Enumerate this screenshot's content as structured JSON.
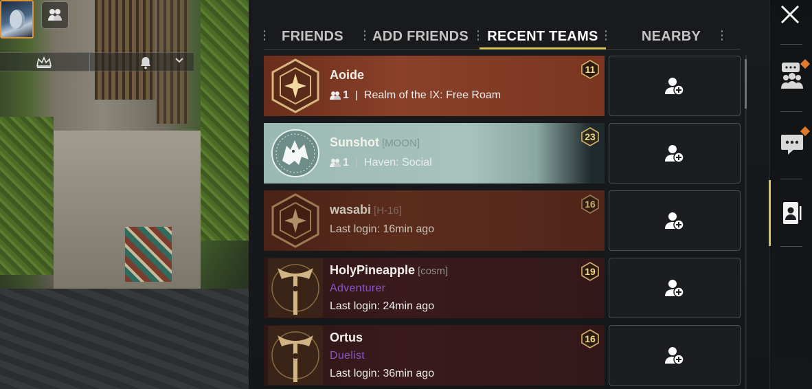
{
  "colors": {
    "accent": "#d6c35a",
    "class_purple": "#8b55c8",
    "notification": "#e07a2a"
  },
  "hud": {
    "avatar_icon": "character-portrait",
    "team_icon": "fireteam-icon",
    "crown_icon": "crown-icon",
    "bell_icon": "bell-icon",
    "dropdown_icon": "chevron-down-icon"
  },
  "tabs": [
    {
      "label": "FRIENDS",
      "active": false
    },
    {
      "label": "ADD FRIENDS",
      "active": false
    },
    {
      "label": "RECENT TEAMS",
      "active": true
    },
    {
      "label": "NEARBY",
      "active": false
    }
  ],
  "players": [
    {
      "name": "Aoide",
      "tag": "",
      "level": "11",
      "members": "1",
      "activity": "Realm of the IX: Free Roam",
      "class": "",
      "last_login": "",
      "style": "rust"
    },
    {
      "name": "Sunshot",
      "tag": "[MOON]",
      "level": "23",
      "members": "1",
      "activity": "Haven: Social",
      "class": "",
      "last_login": "",
      "style": "teal"
    },
    {
      "name": "wasabi",
      "tag": "[H-16]",
      "level": "16",
      "members": "",
      "activity": "",
      "class": "",
      "last_login": "Last login: 16min ago",
      "style": "rust-dim"
    },
    {
      "name": "HolyPineapple",
      "tag": "[cosm]",
      "level": "19",
      "members": "",
      "activity": "",
      "class": "Adventurer",
      "last_login": "Last login: 24min ago",
      "style": "maroon"
    },
    {
      "name": "Ortus",
      "tag": "",
      "level": "16",
      "members": "",
      "activity": "",
      "class": "Duelist",
      "last_login": "Last login: 36min ago",
      "style": "maroon"
    }
  ],
  "add_button_icon": "add-friend-icon",
  "rail": {
    "close_icon": "close-icon",
    "items": [
      {
        "icon": "team-chat-icon",
        "has_notification": true
      },
      {
        "icon": "chat-icon",
        "has_notification": true
      },
      {
        "icon": "contacts-icon",
        "active": true
      }
    ]
  }
}
